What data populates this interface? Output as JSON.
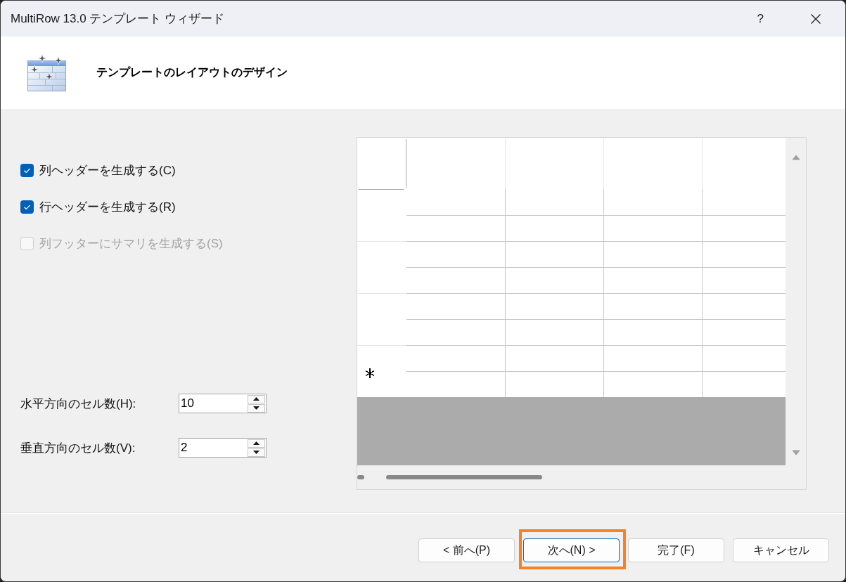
{
  "window": {
    "title": "MultiRow 13.0 テンプレート ウィザード",
    "help": "?"
  },
  "header": {
    "title": "テンプレートのレイアウトのデザイン"
  },
  "options": [
    {
      "label": "列ヘッダーを生成する(C)",
      "checked": true,
      "disabled": false
    },
    {
      "label": "行ヘッダーを生成する(R)",
      "checked": true,
      "disabled": false
    },
    {
      "label": "列フッターにサマリを生成する(S)",
      "checked": false,
      "disabled": true
    }
  ],
  "cell_counts": [
    {
      "label": "水平方向のセル数(H):",
      "value": "10"
    },
    {
      "label": "垂直方向のセル数(V):",
      "value": "2"
    }
  ],
  "buttons": [
    {
      "label": "< 前へ(P)",
      "default": false,
      "highlighted": false
    },
    {
      "label": "次へ(N) >",
      "default": true,
      "highlighted": true
    },
    {
      "label": "完了(F)",
      "default": false,
      "highlighted": false
    },
    {
      "label": "キャンセル",
      "default": false,
      "highlighted": false
    }
  ]
}
